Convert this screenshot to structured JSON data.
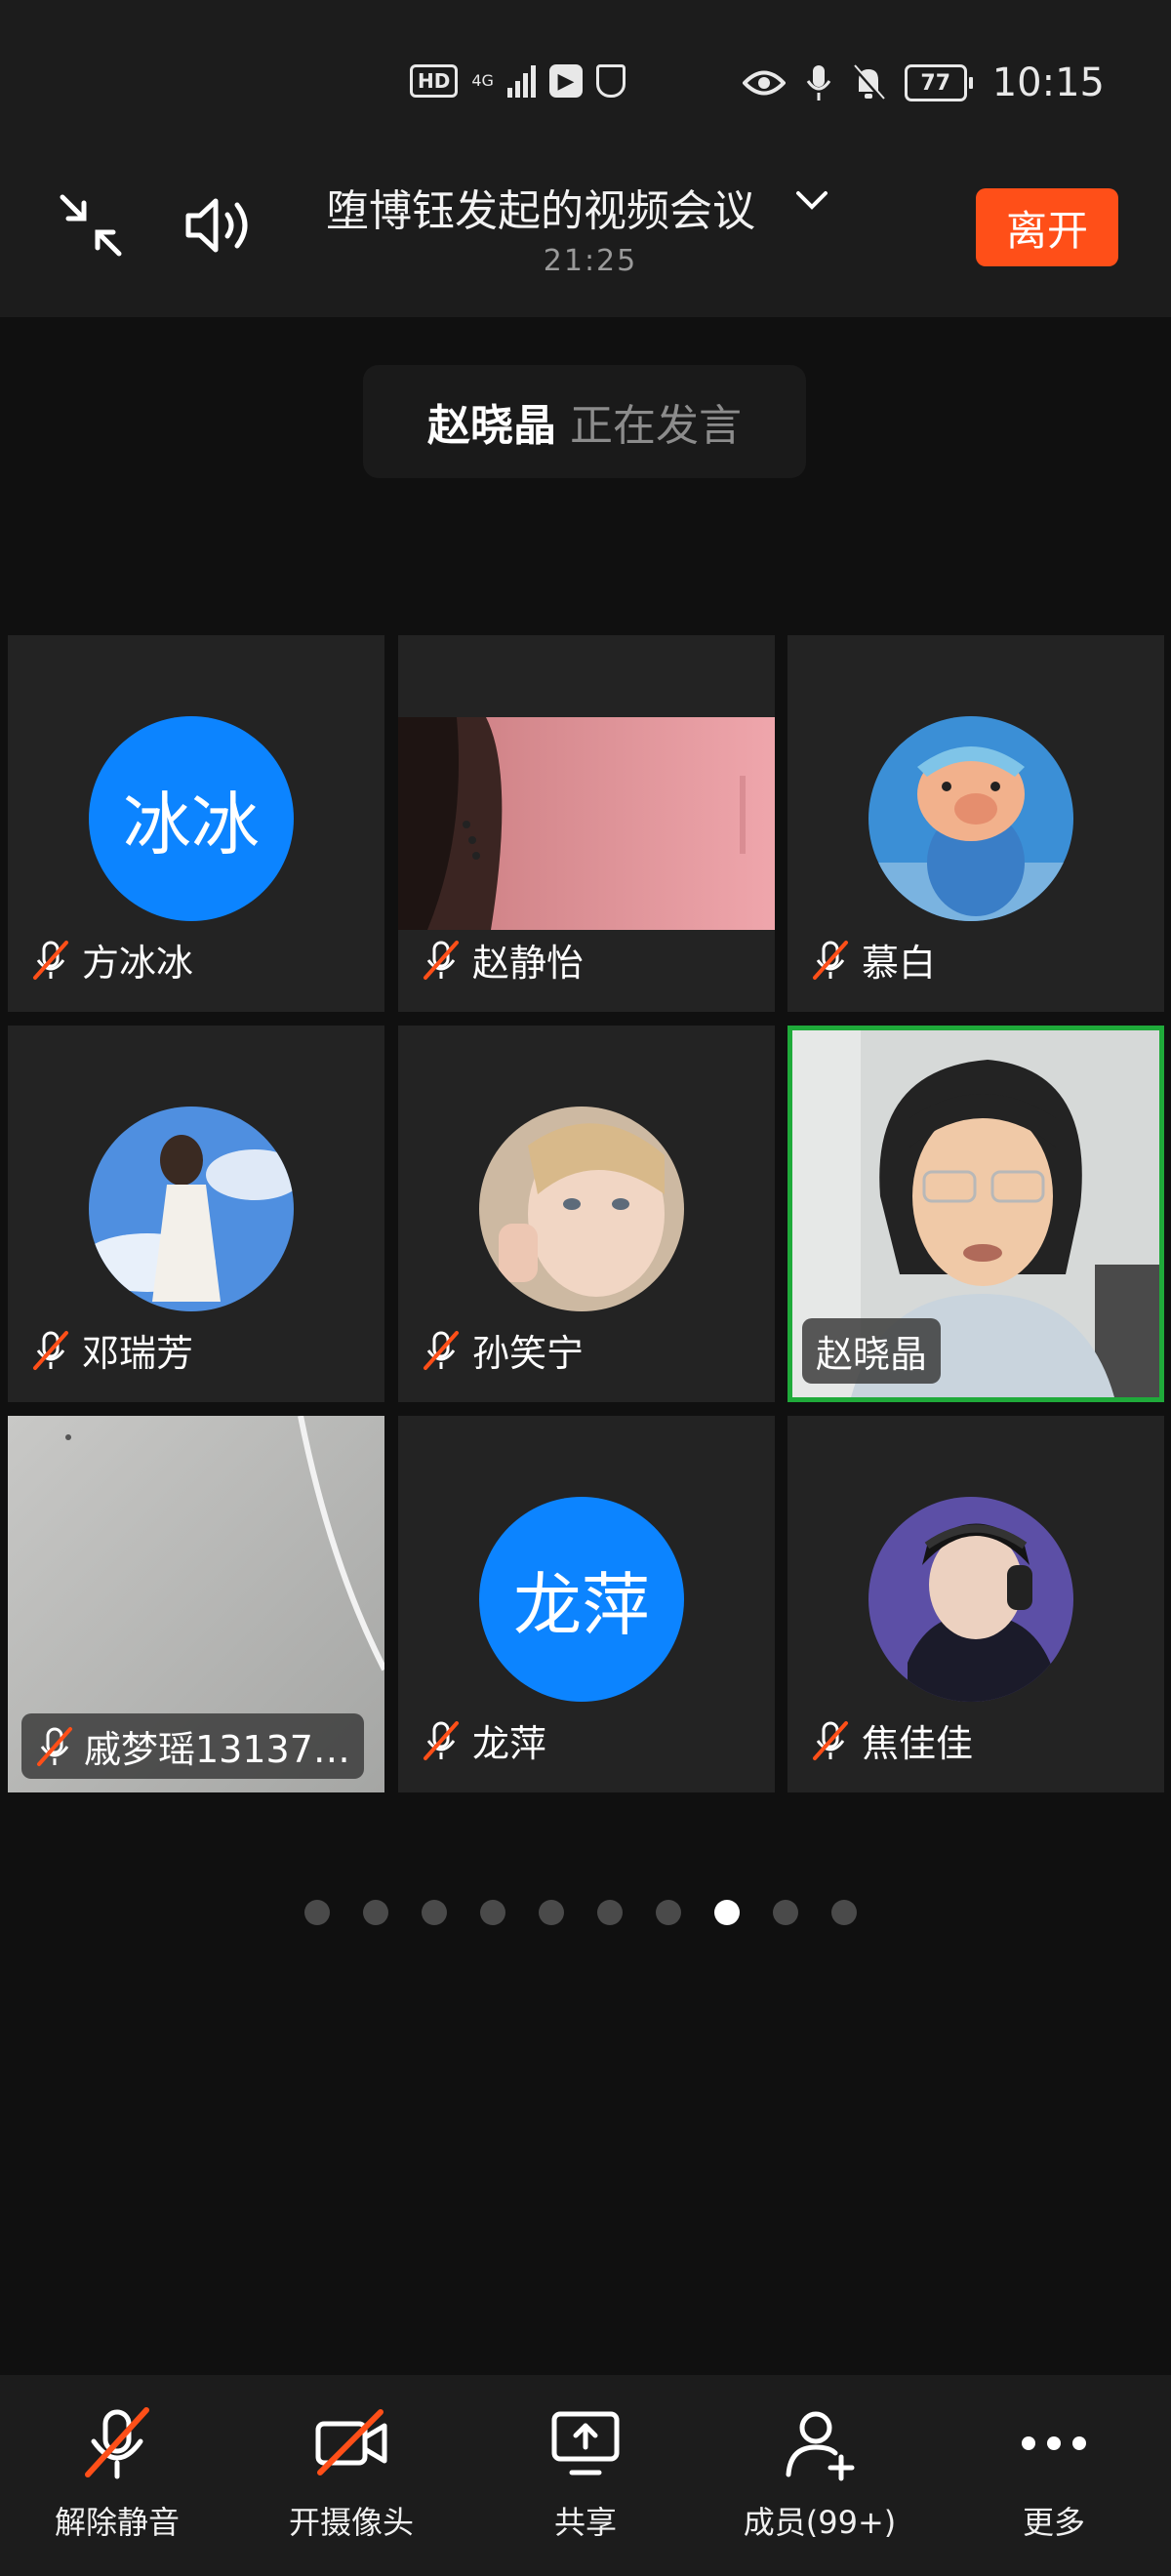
{
  "status_bar": {
    "hd_label": "HD",
    "network_label": "4G",
    "battery_level": "77",
    "time": "10:15",
    "icons": [
      "hd-icon",
      "signal-icon",
      "app-notification-icon",
      "shield-icon",
      "eye-icon",
      "mic-icon",
      "bell-muted-icon",
      "battery-icon"
    ]
  },
  "header": {
    "meeting_title": "堕博钰发起的视频会议",
    "timer": "21:25",
    "leave_label": "离开",
    "leave_color": "#ff4f18"
  },
  "speaker": {
    "name": "赵晓晶",
    "status": "正在发言"
  },
  "participants": [
    {
      "name": "方冰冰",
      "avatar_text": "冰冰",
      "kind": "text-avatar",
      "muted": true
    },
    {
      "name": "赵静怡",
      "kind": "video",
      "muted": true
    },
    {
      "name": "慕白",
      "kind": "photo-avatar",
      "muted": true
    },
    {
      "name": "邓瑞芳",
      "kind": "photo-avatar",
      "muted": true
    },
    {
      "name": "孙笑宁",
      "kind": "photo-avatar",
      "muted": true
    },
    {
      "name": "赵晓晶",
      "kind": "video",
      "muted": false,
      "speaking": true
    },
    {
      "name": "戚梦瑶13137…",
      "kind": "video",
      "muted": true
    },
    {
      "name": "龙萍",
      "avatar_text": "龙萍",
      "kind": "text-avatar",
      "muted": true
    },
    {
      "name": "焦佳佳",
      "kind": "photo-avatar",
      "muted": true
    }
  ],
  "pagination": {
    "total": 10,
    "current": 8
  },
  "toolbar": {
    "unmute_label": "解除静音",
    "camera_label": "开摄像头",
    "share_label": "共享",
    "members_label": "成员(99+)",
    "more_label": "更多"
  },
  "colors": {
    "accent_avatar": "#0c84ff",
    "speaking_border": "#1faa3a",
    "muted_red": "#ff4f18"
  }
}
